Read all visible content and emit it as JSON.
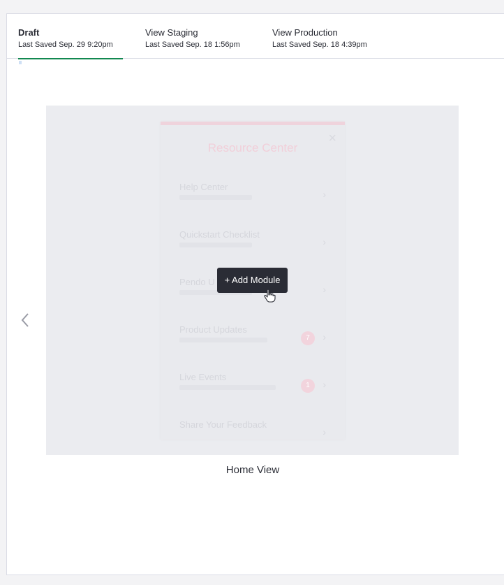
{
  "tabs": [
    {
      "title": "Draft",
      "subtitle": "Last Saved Sep. 29 9:20pm"
    },
    {
      "title": "View Staging",
      "subtitle": "Last Saved Sep. 18 1:56pm"
    },
    {
      "title": "View Production",
      "subtitle": "Last Saved Sep. 18 4:39pm"
    }
  ],
  "preview": {
    "resource_center": {
      "title": "Resource Center",
      "close_icon": "close-icon",
      "items": [
        {
          "title": "Help Center"
        },
        {
          "title": "Quickstart Checklist"
        },
        {
          "title": "Pendo U"
        },
        {
          "title": "Product Updates",
          "badge": "7"
        },
        {
          "title": "Live Events",
          "badge": "1"
        },
        {
          "title": "Share Your Feedback"
        }
      ]
    },
    "add_module_label": "+ Add Module",
    "view_label": "Home View"
  },
  "colors": {
    "accent": "#128850",
    "button_dark": "#2a2c35",
    "preview_bg": "#ebecf0",
    "border": "#dadce5"
  },
  "icons": [
    "chevron-left-icon",
    "hand-pointer-icon",
    "chevron-right-icon",
    "close-icon"
  ]
}
